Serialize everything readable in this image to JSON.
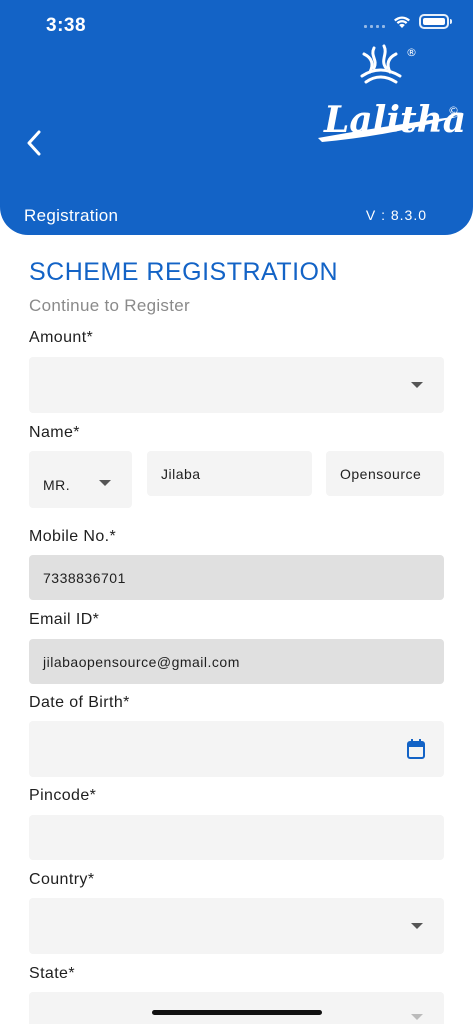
{
  "status_bar": {
    "time": "3:38"
  },
  "header": {
    "brand": "Lalithaa",
    "registered_mark": "®",
    "copyright_mark": "©",
    "section_title": "Registration",
    "version": "V : 8.3.0"
  },
  "form": {
    "title": "SCHEME REGISTRATION",
    "subtitle": "Continue to Register",
    "amount": {
      "label": "Amount*",
      "value": ""
    },
    "name": {
      "label": "Name*",
      "salutation": "MR.",
      "first_name": "Jilaba",
      "last_name": "Opensource"
    },
    "mobile": {
      "label": "Mobile No.*",
      "value": "7338836701"
    },
    "email": {
      "label": "Email ID*",
      "value": "jilabaopensource@gmail.com"
    },
    "dob": {
      "label": "Date of Birth*",
      "value": ""
    },
    "pincode": {
      "label": "Pincode*",
      "value": ""
    },
    "country": {
      "label": "Country*",
      "value": ""
    },
    "state": {
      "label": "State*",
      "value": ""
    }
  },
  "colors": {
    "primary": "#1363c6",
    "field_bg": "#f4f4f4",
    "readonly_bg": "#e0e0e0"
  }
}
